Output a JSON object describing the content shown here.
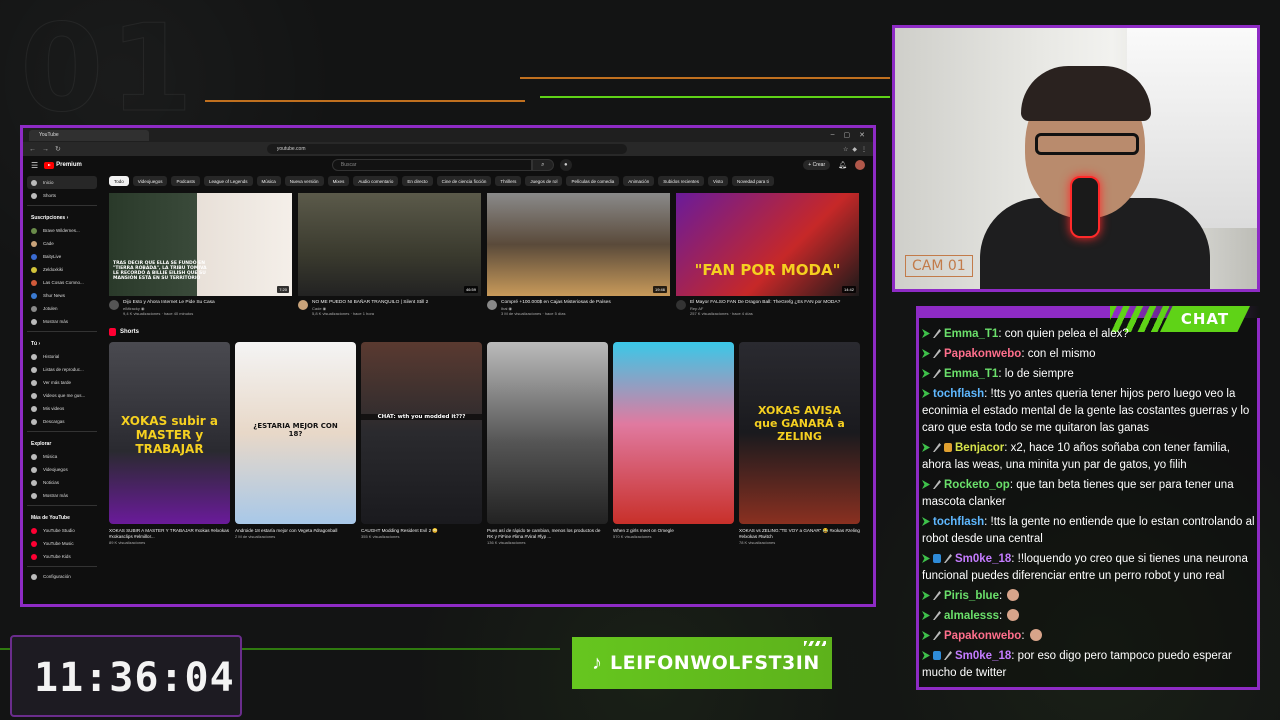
{
  "overlay": {
    "bg_number": "01",
    "cam_label": "CAM 01",
    "chat_label": "CHAT",
    "clock": "11:36:04",
    "tiktok_handle": "LEIFONWOLFST3IN",
    "accent": "#8e2bc5",
    "green": "#5fd317"
  },
  "browser": {
    "tab_title": "YouTube",
    "url": "youtube.com",
    "window_controls": [
      "–",
      "▢",
      "✕"
    ]
  },
  "youtube": {
    "logo_text": "Premium",
    "search_placeholder": "Buscar",
    "create_label": "+ Crear",
    "sidebar_main": [
      {
        "label": "Inicio",
        "active": true
      },
      {
        "label": "Shorts",
        "active": false
      }
    ],
    "subs_heading": "Suscripciones ›",
    "subscriptions": [
      "Brave Wildernes...",
      "Cade",
      "BaityLive",
      "Zeldoxkiki",
      "Las Cosas Comno...",
      "Shur News",
      "Jotulen",
      "Mostrar más"
    ],
    "you_heading": "Tú ›",
    "you_items": [
      "Historial",
      "Listas de reproduc...",
      "Ver más tarde",
      "Videos que me gus...",
      "Mis videos",
      "Descargas"
    ],
    "explore_heading": "Explorar",
    "explore_items": [
      "Música",
      "Videojuegos",
      "Noticias",
      "Mostrar más"
    ],
    "more_heading": "Más de YouTube",
    "more_items": [
      "YouTube Studio",
      "YouTube Music",
      "YouTube Kids"
    ],
    "settings_label": "Configuración",
    "chips": [
      "Todo",
      "Videojuegos",
      "Podcasts",
      "League of Legends",
      "Música",
      "Nueva versión",
      "Mixes",
      "Audio comentario",
      "En directo",
      "Cine de ciencia ficción",
      "Thrillers",
      "Juegos de rol",
      "Películas de comedia",
      "Animación",
      "Subidos recientes",
      "Visto",
      "Novedad para ti"
    ],
    "videos": [
      {
        "title": "Dijo Esto y Ahora Internet Le Pide Su Casa",
        "channel": "elMiracky ◉",
        "stats": "9,4 K visualizaciones · hace 40 minutos",
        "duration": "7:20",
        "thumb_text": "TRAS DECIR QUE ELLA SE FUNDÓ EN \"TIERRA ROBADA\", LA TRIBU TOMIVA LE RECORDÓ A BILLIE EILISH QUE SU MANSIÓN ESTÁ EN SU TERRITORIO"
      },
      {
        "title": "NO ME PUEDO NI BAÑAR TRANQUILO | Silent Still 2",
        "channel": "Cade ◉",
        "stats": "5,8 K visualizaciones · hace 1 hora",
        "duration": "46:59",
        "thumb_text": ""
      },
      {
        "title": "Compré +100.000$ en Cajas Misteriosas de Países",
        "channel": "Ibai ◉",
        "stats": "3 M de visualizaciones · hace 5 días",
        "duration": "19:46",
        "thumb_text": ""
      },
      {
        "title": "El Mayor FALSO FAN De Dragon Ball: TheGrefg ¿Es FAN por MODA?",
        "channel": "Rep AF",
        "stats": "257 K visualizaciones · hace 4 días",
        "duration": "14:42",
        "thumb_text": "\"FAN POR MODA\""
      }
    ],
    "shorts_heading": "Shorts",
    "shorts": [
      {
        "title": "XOKAS SUBIR A MASTER Y TRABAJAR #xokas #elxokas #xokasclips #elmillor...",
        "views": "89 K visualizaciones",
        "thumb_text": "XOKAS subir a MASTER y TRABAJAR"
      },
      {
        "title": "Androide 18 estaría mejor con Vegeta #dragonball",
        "views": "2 M de visualizaciones",
        "thumb_text": "¿ESTARIA MEJOR CON 18?"
      },
      {
        "title": "CAUGHT Modding Resident Evil 2 😳",
        "views": "355 K visualizaciones",
        "thumb_text": "CHAT: wth you modded it???"
      },
      {
        "title": "Pues así de rápido te cambian, menos los productos de RK y FiFine #lima #Viral #fyp ...",
        "views": "136 K visualizaciones",
        "thumb_text": ""
      },
      {
        "title": "When 2 girls meet on Omegle",
        "views": "570 K visualizaciones",
        "thumb_text": ""
      },
      {
        "title": "XOKAS vs ZELING:\"TE VOY a GANAR\" 😂 #xokas #zeling #elxokas #twitch",
        "views": "78 K visualizaciones",
        "thumb_text": "XOKAS AVISA que GANARÁ a ZELING"
      }
    ]
  },
  "chat": {
    "messages": [
      {
        "badges": [
          "green",
          "sword"
        ],
        "user": "Emma_T1",
        "color": "#6be06b",
        "text": ": con quien pelea el alex?"
      },
      {
        "badges": [
          "green",
          "sword"
        ],
        "user": "Papakonwebo",
        "color": "#ff6f8c",
        "text": ": con el mismo"
      },
      {
        "badges": [
          "green",
          "sword"
        ],
        "user": "Emma_T1",
        "color": "#6be06b",
        "text": ": lo de siempre"
      },
      {
        "badges": [
          "green"
        ],
        "user": "tochflash",
        "color": "#5fb8ff",
        "text": ": !tts yo antes queria tener hijos pero luego veo la econimia el estado mental de la gente las costantes guerras y lo caro que esta todo se me quitaron las ganas"
      },
      {
        "badges": [
          "green",
          "sword",
          "gold"
        ],
        "user": "Benjacor",
        "color": "#d7e34a",
        "text": ": x2, hace 10 años soñaba con tener familia, ahora las weas, una minita yun par de gatos, yo filih"
      },
      {
        "badges": [
          "green",
          "sword"
        ],
        "user": "Rocketo_op",
        "color": "#6be06b",
        "text": ": que tan beta tienes que ser para tener una mascota clanker"
      },
      {
        "badges": [
          "green"
        ],
        "user": "tochflash",
        "color": "#5fb8ff",
        "text": ": !tts la gente no entiende que lo estan controlando al robot desde una central"
      },
      {
        "badges": [
          "green",
          "blue",
          "sword"
        ],
        "user": "Sm0ke_18",
        "color": "#c47cff",
        "text": ": !!loquendo yo creo que si tienes una neurona funcional puedes diferenciar entre un perro robot y uno real"
      },
      {
        "badges": [
          "green",
          "sword"
        ],
        "user": "Piris_blue",
        "color": "#6be06b",
        "text": ":",
        "emote": true
      },
      {
        "badges": [
          "green",
          "sword"
        ],
        "user": "almalesss",
        "color": "#6be06b",
        "text": ":",
        "emote": true
      },
      {
        "badges": [
          "green",
          "sword"
        ],
        "user": "Papakonwebo",
        "color": "#ff6f8c",
        "text": ":",
        "emote": true
      },
      {
        "badges": [
          "green",
          "blue",
          "sword"
        ],
        "user": "Sm0ke_18",
        "color": "#c47cff",
        "text": ": por eso digo pero tampoco puedo esperar mucho de twitter"
      }
    ]
  }
}
